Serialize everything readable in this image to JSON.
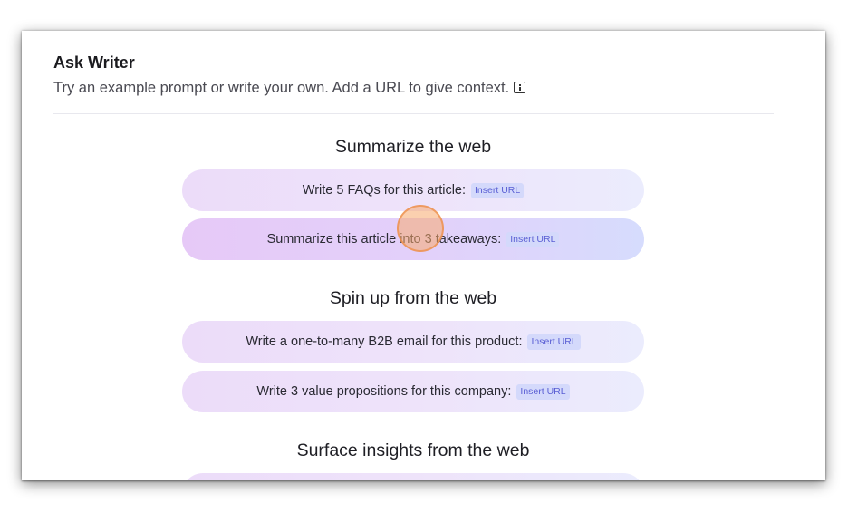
{
  "header": {
    "title": "Ask Writer",
    "subtitle": "Try an example prompt or write your own. Add a URL to give context.",
    "info_icon": "info-icon"
  },
  "sections": [
    {
      "heading": "Summarize the web",
      "prompts": [
        {
          "label": "Write 5 FAQs for this article:",
          "tag": "Insert URL"
        },
        {
          "label": "Summarize this article into 3 takeaways:",
          "tag": "Insert URL"
        }
      ]
    },
    {
      "heading": "Spin up from the web",
      "prompts": [
        {
          "label": "Write a one-to-many B2B email for this product:",
          "tag": "Insert URL"
        },
        {
          "label": "Write 3 value propositions for this company:",
          "tag": "Insert URL"
        }
      ]
    },
    {
      "heading": "Surface insights from the web",
      "prompts": []
    }
  ],
  "colors": {
    "pill_start": "#ecdcf9",
    "pill_end": "#ebecfd",
    "tag_text": "#5a5fd4",
    "tag_bg": "#d4d9fb",
    "cursor_highlight": "#f7aa6e"
  }
}
